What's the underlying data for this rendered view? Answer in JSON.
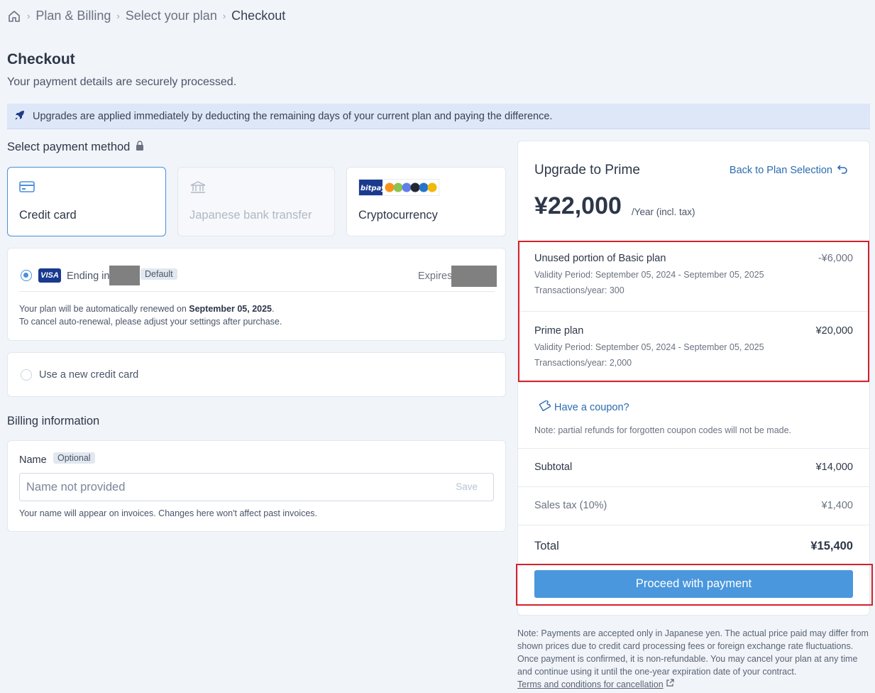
{
  "breadcrumb": {
    "items": [
      "Plan & Billing",
      "Select your plan"
    ],
    "current": "Checkout"
  },
  "page": {
    "title": "Checkout",
    "subtitle": "Your payment details are securely processed."
  },
  "banner": {
    "text": "Upgrades are applied immediately by deducting the remaining days of your current plan and paying the difference."
  },
  "payment_method": {
    "title": "Select payment method",
    "options": [
      {
        "label": "Credit card",
        "state": "selected"
      },
      {
        "label": "Japanese bank transfer",
        "state": "disabled"
      },
      {
        "label": "Cryptocurrency",
        "state": "normal",
        "logo_text": "bitpay"
      }
    ]
  },
  "saved_card": {
    "brand": "VISA",
    "ending_label": "Ending in",
    "default_badge": "Default",
    "expires_label": "Expires",
    "renew_text_prefix": "Your plan will be automatically renewed on ",
    "renew_date": "September 05, 2025",
    "renew_text_suffix": ".",
    "cancel_text": "To cancel auto-renewal, please adjust your settings after purchase."
  },
  "new_card": {
    "label": "Use a new credit card"
  },
  "billing": {
    "title": "Billing information",
    "name_label": "Name",
    "optional_badge": "Optional",
    "placeholder": "Name not provided",
    "save_label": "Save",
    "help_text": "Your name will appear on invoices. Changes here won't affect past invoices."
  },
  "summary": {
    "title": "Upgrade to Prime",
    "back_link": "Back to Plan Selection",
    "price": "¥22,000",
    "price_suffix": "/Year (incl. tax)",
    "lines": [
      {
        "name": "Unused portion of Basic plan",
        "amount": "-¥6,000",
        "validity": "Validity Period: September 05, 2024 - September 05, 2025",
        "transactions": "Transactions/year: 300"
      },
      {
        "name": "Prime plan",
        "amount": "¥20,000",
        "validity": "Validity Period: September 05, 2024 - September 05, 2025",
        "transactions": "Transactions/year: 2,000"
      }
    ],
    "coupon_link": "Have a coupon?",
    "coupon_note": "Note: partial refunds for forgotten coupon codes will not be made.",
    "subtotal_label": "Subtotal",
    "subtotal": "¥14,000",
    "tax_label": "Sales tax (10%)",
    "tax": "¥1,400",
    "total_label": "Total",
    "total": "¥15,400",
    "pay_button": "Proceed with payment"
  },
  "footer_note": {
    "text": "Note: Payments are accepted only in Japanese yen. The actual price paid may differ from shown prices due to credit card processing fees or foreign exchange rate fluctuations. Once payment is confirmed, it is non-refundable. You may cancel your plan at any time and continue using it until the one-year expiration date of your contract.",
    "link": "Terms and conditions for cancellation"
  },
  "colors": {
    "accent": "#4a97dd",
    "highlight_border": "#d6212b",
    "banner_bg": "#dde7f8",
    "page_bg": "#f1f4f9"
  }
}
